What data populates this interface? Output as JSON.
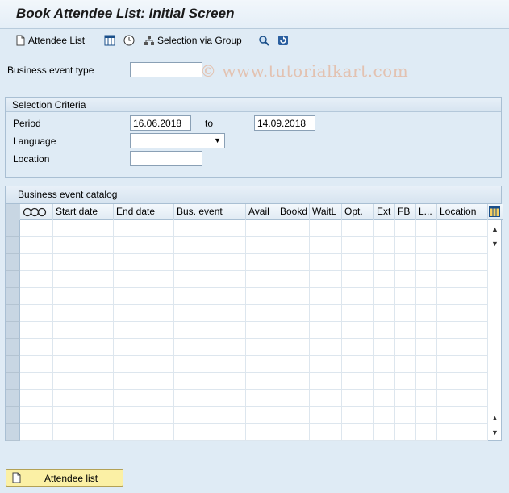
{
  "window": {
    "title": "Book Attendee List: Initial Screen"
  },
  "toolbar": {
    "attendee_list": "Attendee List",
    "selection_via_group": "Selection via Group",
    "watermark": "© www.tutorialkart.com"
  },
  "form": {
    "business_event_type": {
      "label": "Business event type",
      "value": ""
    }
  },
  "selection_criteria": {
    "title": "Selection Criteria",
    "period_label": "Period",
    "period_from": "16.06.2018",
    "to_label": "to",
    "period_to": "14.09.2018",
    "language_label": "Language",
    "language_value": "",
    "location_label": "Location",
    "location_value": ""
  },
  "catalog": {
    "title": "Business event catalog",
    "columns": [
      "",
      "Start date",
      "End date",
      "Bus. event",
      "Avail",
      "Bookd",
      "WaitL",
      "Opt.",
      "Ext",
      "FB",
      "L...",
      "Location"
    ],
    "rows": 13
  },
  "footer": {
    "button_label": "Attendee list"
  }
}
